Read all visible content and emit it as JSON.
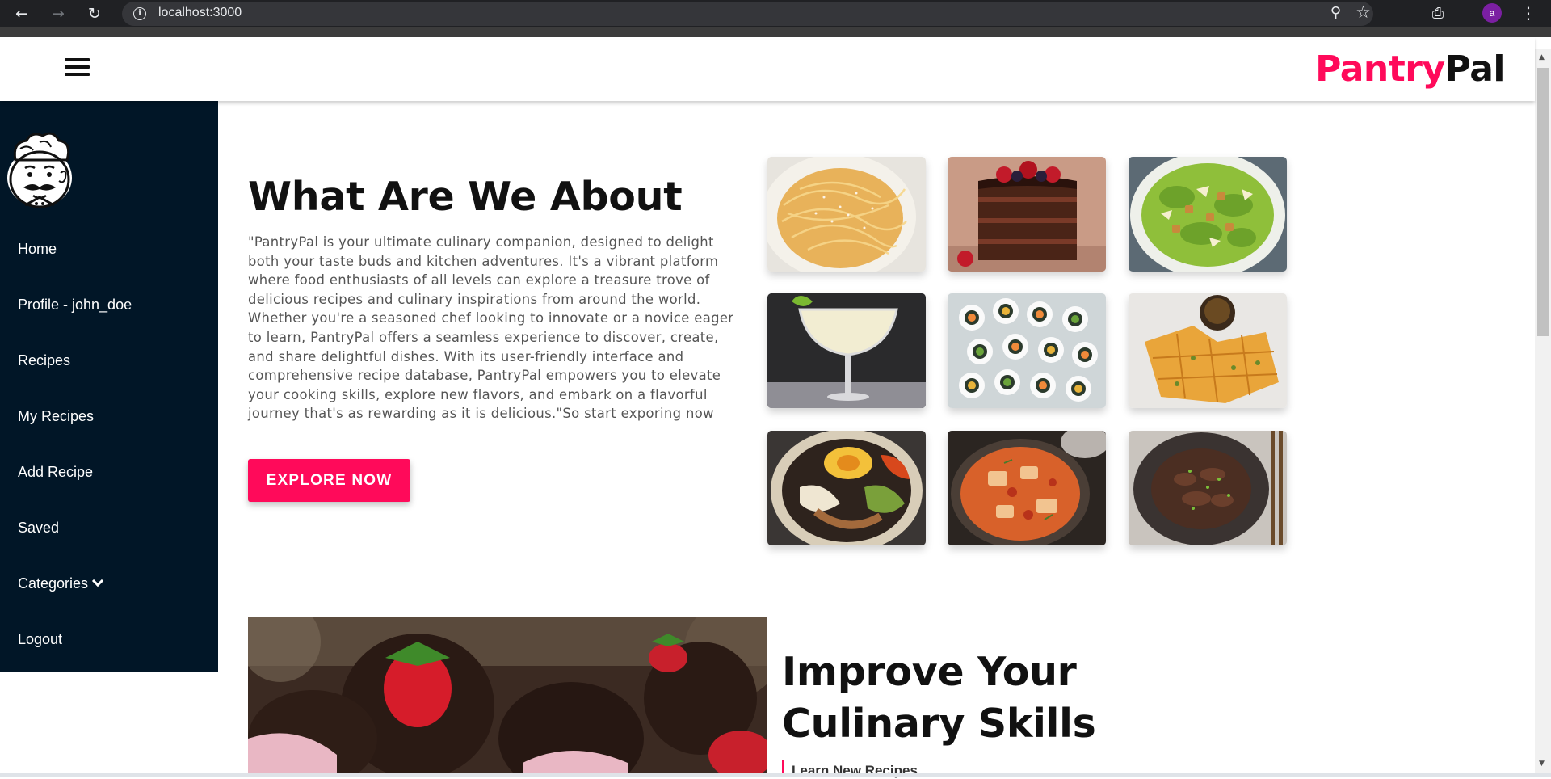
{
  "browser": {
    "url": "localhost:3000",
    "back_icon": "back-arrow-icon",
    "forward_icon": "forward-arrow-icon",
    "reload_icon": "reload-icon",
    "profile_initial": "a"
  },
  "header": {
    "brand_part1": "Pantry",
    "brand_part2": "Pal",
    "brand_color": "#ff0a5a",
    "menu_icon": "hamburger-menu-icon"
  },
  "sidebar": {
    "background": "#011627",
    "logo_icon": "chef-logo-icon",
    "items": [
      {
        "label": "Home"
      },
      {
        "label": "Profile - john_doe"
      },
      {
        "label": "Recipes"
      },
      {
        "label": "My Recipes"
      },
      {
        "label": "Add Recipe"
      },
      {
        "label": "Saved"
      },
      {
        "label": "Categories"
      },
      {
        "label": "Logout"
      }
    ]
  },
  "about": {
    "title": "What Are We About",
    "body": "\"PantryPal is your ultimate culinary companion, designed to delight both your taste buds and kitchen adventures. It's a vibrant platform where food enthusiasts of all levels can explore a treasure trove of delicious recipes and culinary inspirations from around the world. Whether you're a seasoned chef looking to innovate or a novice eager to learn, PantryPal offers a seamless experience to discover, create, and share delightful dishes. With its user-friendly interface and comprehensive recipe database, PantryPal empowers you to elevate your cooking skills, explore new flavors, and embark on a flavorful journey that's as rewarding as it is delicious.\"So start exporing now",
    "button_label": "EXPLORE NOW"
  },
  "gallery": [
    {
      "name": "spaghetti-photo"
    },
    {
      "name": "chocolate-cake-photo"
    },
    {
      "name": "caesar-salad-photo"
    },
    {
      "name": "margarita-cocktail-photo"
    },
    {
      "name": "sushi-rolls-photo"
    },
    {
      "name": "korean-pancake-photo"
    },
    {
      "name": "bibimbap-photo"
    },
    {
      "name": "kimchi-stew-photo"
    },
    {
      "name": "bulgogi-photo"
    }
  ],
  "skills": {
    "title": "Improve Your Culinary Skills",
    "subtitle": "Learn New Recipes",
    "photo": "chocolate-strawberries-photo"
  }
}
